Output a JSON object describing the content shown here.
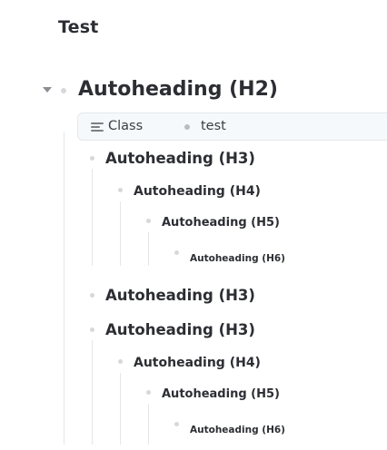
{
  "page": {
    "title": "Test"
  },
  "blocks": {
    "h2": {
      "text": "Autoheading (H2)"
    },
    "property": {
      "key": "Class",
      "value": "test",
      "icon": "list-lines-icon"
    },
    "h3_a": {
      "text": "Autoheading (H3)"
    },
    "h4_a": {
      "text": "Autoheading (H4)"
    },
    "h5_a": {
      "text": "Autoheading (H5)"
    },
    "h6_a": {
      "text": "Autoheading (H6)"
    },
    "h3_b": {
      "text": "Autoheading (H3)"
    },
    "h3_c": {
      "text": "Autoheading (H3)"
    },
    "h4_b": {
      "text": "Autoheading (H4)"
    },
    "h5_b": {
      "text": "Autoheading (H5)"
    },
    "h6_b": {
      "text": "Autoheading (H6)"
    }
  },
  "colors": {
    "text": "#2c2e33",
    "bullet": "#d6d8dc",
    "guide": "#e4e6ea",
    "property_bg": "#f6f9fb"
  }
}
